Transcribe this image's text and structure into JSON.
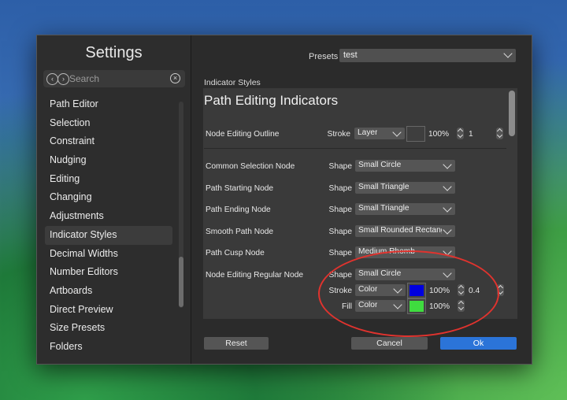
{
  "sidebar": {
    "title": "Settings",
    "search_placeholder": "Search",
    "items": [
      {
        "label": "Path Editor"
      },
      {
        "label": "Selection"
      },
      {
        "label": "Constraint"
      },
      {
        "label": "Nudging"
      },
      {
        "label": "Editing"
      },
      {
        "label": "Changing"
      },
      {
        "label": "Adjustments"
      },
      {
        "label": "Indicator Styles"
      },
      {
        "label": "Decimal Widths"
      },
      {
        "label": "Number Editors"
      },
      {
        "label": "Artboards"
      },
      {
        "label": "Direct Preview"
      },
      {
        "label": "Size Presets"
      },
      {
        "label": "Folders"
      }
    ]
  },
  "presets": {
    "label": "Presets",
    "value": "test"
  },
  "section_label": "Indicator Styles",
  "panel_title": "Path Editing Indicators",
  "rows": {
    "outline": {
      "label": "Node Editing Outline",
      "kw": "Stroke",
      "value": "Layer",
      "pct": "100%",
      "num": "1"
    },
    "common": {
      "label": "Common Selection Node",
      "kw": "Shape",
      "value": "Small Circle"
    },
    "start": {
      "label": "Path Starting Node",
      "kw": "Shape",
      "value": "Small Triangle"
    },
    "end": {
      "label": "Path Ending Node",
      "kw": "Shape",
      "value": "Small Triangle"
    },
    "smooth": {
      "label": "Smooth Path Node",
      "kw": "Shape",
      "value": "Small Rounded Rectangle"
    },
    "cusp": {
      "label": "Path Cusp Node",
      "kw": "Shape",
      "value": "Medium Rhomb"
    },
    "regular": {
      "label": "Node Editing Regular Node",
      "shape_kw": "Shape",
      "shape_value": "Small Circle",
      "stroke_kw": "Stroke",
      "stroke_value": "Color",
      "stroke_color": "#0000e0",
      "stroke_pct": "100%",
      "stroke_num": "0.4",
      "fill_kw": "Fill",
      "fill_value": "Color",
      "fill_color": "#3fdc3f",
      "fill_pct": "100%"
    }
  },
  "buttons": {
    "reset": "Reset",
    "cancel": "Cancel",
    "ok": "Ok"
  },
  "annotation_color": "#e0332e"
}
